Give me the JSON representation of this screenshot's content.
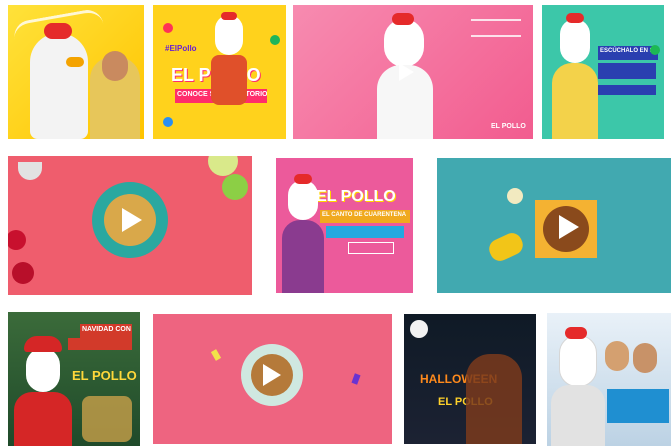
{
  "gallery": {
    "tiles": [
      {
        "id": "t1",
        "kind": "image",
        "title": "",
        "accent": "#ffd400"
      },
      {
        "id": "t2",
        "kind": "image",
        "title": "EL POLLO",
        "subtitle": "CONOCE SU REPERTORIO",
        "hashtag": "#ElPollo",
        "accent": "#ffcf1a"
      },
      {
        "id": "t3",
        "kind": "video",
        "title": "EL POLLO",
        "accent": "#f25c8f"
      },
      {
        "id": "t4",
        "kind": "image",
        "title": "ESCÚCHALO EN SPOTIFY",
        "accent": "#3cc7a9"
      },
      {
        "id": "t5",
        "kind": "video",
        "accent": "#ef5d6d"
      },
      {
        "id": "t6",
        "kind": "image",
        "title": "EL POLLO",
        "subtitle": "EL CANTO DE CUARENTENA",
        "accent": "#ec5a9b"
      },
      {
        "id": "t7",
        "kind": "video",
        "accent": "#41a9b0"
      },
      {
        "id": "t8",
        "kind": "image",
        "title": "EL POLLO",
        "subtitle": "NAVIDAD CON",
        "accent": "#2f8a50"
      },
      {
        "id": "t9",
        "kind": "video",
        "accent": "#ee6480"
      },
      {
        "id": "t10",
        "kind": "image",
        "title": "EL POLLO",
        "subtitle": "HALLOWEEN",
        "accent": "#0f1a26"
      },
      {
        "id": "t11",
        "kind": "image",
        "subtitle": "",
        "accent": "#1f8fd1"
      }
    ]
  }
}
